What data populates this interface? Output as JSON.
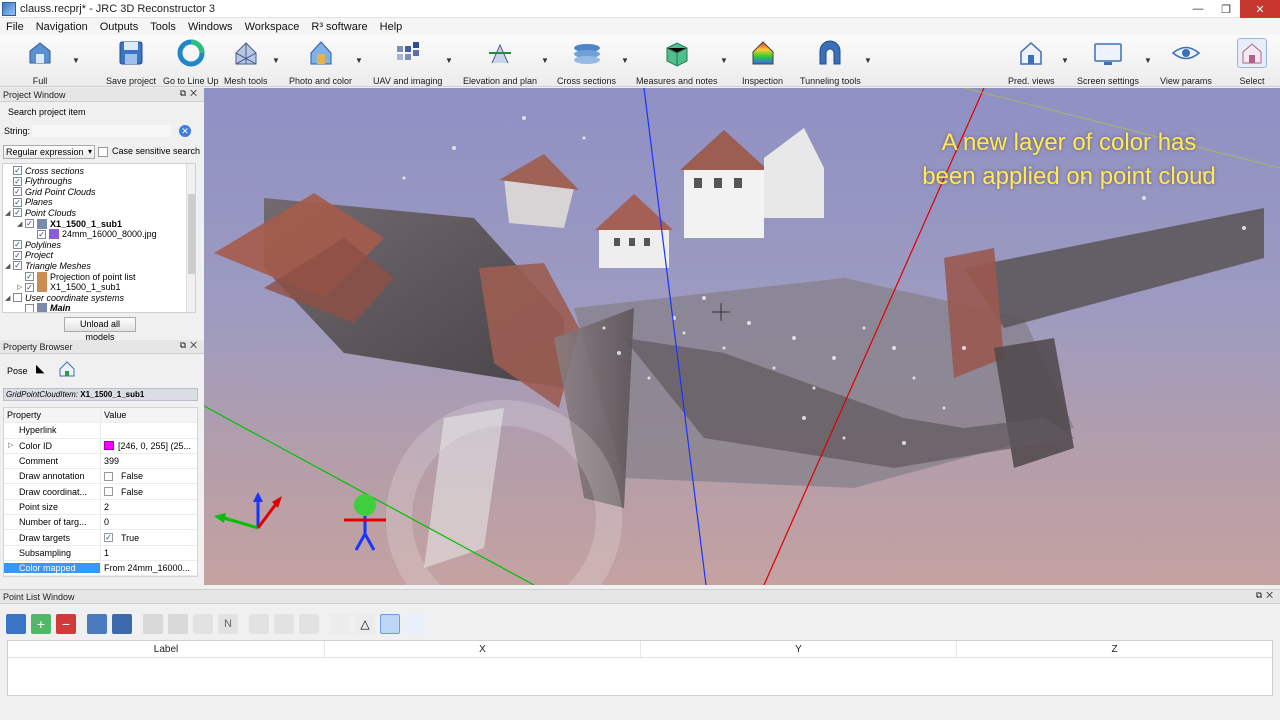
{
  "window": {
    "title": "clauss.recprj* - JRC 3D Reconstructor 3",
    "minimize": "—",
    "maximize": "❐",
    "close": "✕"
  },
  "menu": [
    "File",
    "Navigation",
    "Outputs",
    "Tools",
    "Windows",
    "Workspace",
    "R³ software",
    "Help"
  ],
  "toolbar": {
    "full": "Full",
    "save_project": "Save project",
    "go_to_line_up": "Go to Line Up",
    "mesh_tools": "Mesh tools",
    "photo_and_color": "Photo and color",
    "uav_and_imaging": "UAV and imaging",
    "elevation_and_plan": "Elevation and plan",
    "cross_sections": "Cross sections",
    "measures_and_notes": "Measures and notes",
    "inspection": "Inspection",
    "tunneling_tools": "Tunneling tools",
    "pred_views": "Pred. views",
    "screen_settings": "Screen settings",
    "view_params": "View params",
    "select": "Select"
  },
  "project_window": {
    "title": "Project Window",
    "search_label": "Search project item",
    "string_label": "String:",
    "string_value": "",
    "regex_option": "Regular expression",
    "case_sensitive": "Case sensitive search",
    "unload_button": "Unload all models",
    "tree": [
      {
        "label": "Cross sections",
        "level": 1,
        "expander": "",
        "checked": true,
        "italic": true
      },
      {
        "label": "Flythroughs",
        "level": 1,
        "expander": "",
        "checked": true,
        "italic": true
      },
      {
        "label": "Grid Point Clouds",
        "level": 1,
        "expander": "",
        "checked": true,
        "italic": true
      },
      {
        "label": "Planes",
        "level": 1,
        "expander": "",
        "checked": true,
        "italic": true
      },
      {
        "label": "Point Clouds",
        "level": 1,
        "expander": "◢",
        "checked": true,
        "italic": true
      },
      {
        "label": "X1_1500_1_sub1",
        "level": 2,
        "expander": "◢",
        "checked": true,
        "bold": true
      },
      {
        "label": "24mm_16000_8000.jpg",
        "level": 3,
        "expander": "",
        "checked": true
      },
      {
        "label": "Polylines",
        "level": 1,
        "expander": "",
        "checked": true,
        "italic": true
      },
      {
        "label": "Project",
        "level": 1,
        "expander": "",
        "checked": true,
        "italic": true
      },
      {
        "label": "Triangle Meshes",
        "level": 1,
        "expander": "◢",
        "checked": true,
        "italic": true
      },
      {
        "label": "Projection of point list",
        "level": 2,
        "expander": "",
        "checked": true
      },
      {
        "label": "X1_1500_1_sub1",
        "level": 2,
        "expander": "▷",
        "checked": true
      },
      {
        "label": "User coordinate systems",
        "level": 1,
        "expander": "◢",
        "checked": false,
        "italic": true
      },
      {
        "label": "Main",
        "level": 2,
        "expander": "",
        "checked": false,
        "bold": true,
        "italic": true
      }
    ]
  },
  "property_browser": {
    "title": "Property Browser",
    "pose_label": "Pose",
    "item_type": "GridPointCloudItem:",
    "item_name": "X1_1500_1_sub1",
    "col_property": "Property",
    "col_value": "Value",
    "rows": [
      {
        "key": "Hyperlink",
        "value": ""
      },
      {
        "key": "Color ID",
        "value": "[246, 0, 255] (25...",
        "expander": "▷",
        "swatch": "#f600ff"
      },
      {
        "key": "Comment",
        "value": "399"
      },
      {
        "key": "Draw annotation",
        "value": "False",
        "check": false
      },
      {
        "key": "Draw coordinat...",
        "value": "False",
        "check": false
      },
      {
        "key": "Point size",
        "value": "2"
      },
      {
        "key": "Number of targ...",
        "value": "0"
      },
      {
        "key": "Draw targets",
        "value": "True",
        "check": true
      },
      {
        "key": "Subsampling",
        "value": "1"
      },
      {
        "key": "Color mapped",
        "value": "From 24mm_16000...",
        "selected": true
      }
    ]
  },
  "viewport": {
    "annotation_line1": "A new layer of color has",
    "annotation_line2": "been applied on point cloud",
    "colors": {
      "x_axis": "#e00000",
      "y_axis": "#00c000",
      "z_axis": "#1a33ff"
    }
  },
  "point_list": {
    "title": "Point List Window",
    "columns": [
      "Label",
      "X",
      "Y",
      "Z"
    ]
  }
}
